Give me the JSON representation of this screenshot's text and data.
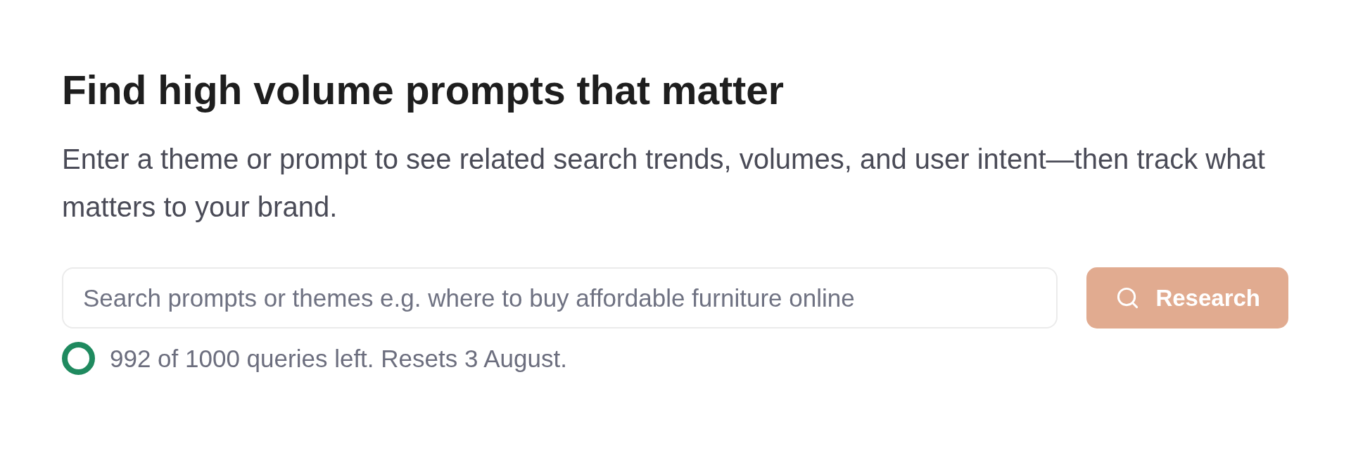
{
  "heading": "Find high volume prompts that matter",
  "description": "Enter a theme or prompt to see related search trends, volumes, and user intent—then track what matters to your brand.",
  "search": {
    "placeholder": "Search prompts or themes e.g. where to buy affordable furniture online",
    "button": {
      "label": "Research",
      "disabled": true
    }
  },
  "quota": {
    "text": "992 of 1000 queries left. Resets 3 August."
  }
}
